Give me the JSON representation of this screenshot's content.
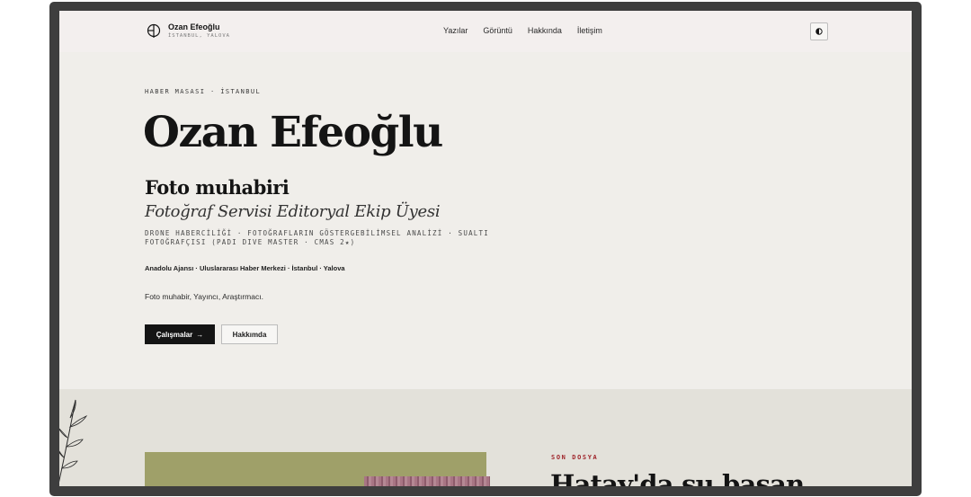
{
  "header": {
    "brand_name": "Ozan Efeoğlu",
    "brand_location": "İSTANBUL, YALOVA",
    "nav": [
      {
        "label": "Yazılar"
      },
      {
        "label": "Görüntü"
      },
      {
        "label": "Hakkında"
      },
      {
        "label": "İletişim"
      }
    ],
    "theme_toggle_icon": "half-circle-contrast-icon"
  },
  "hero": {
    "kicker": "HABER MASASI · İSTANBUL",
    "title": "Ozan Efeoğlu",
    "role": "Foto muhabiri",
    "role_subtitle": "Fotoğraf Servisi Editoryal Ekip Üyesi",
    "skills": "DRONE HABERCİLİĞİ · FOTOĞRAFLARIN GÖSTERGEBİLİMSEL ANALİZİ · SUALTI FOTOĞRAFÇISI (PADI DIVE MASTER · CMAS 2★)",
    "organizations": "Anadolu Ajansı · Uluslararası Haber Merkezi · İstanbul · Yalova",
    "bio": "Foto muhabir, Yayıncı, Araştırmacı.",
    "primary_button": "Çalışmalar",
    "primary_button_arrow": "→",
    "secondary_button": "Hakkımda"
  },
  "featured": {
    "kicker": "SON DOSYA",
    "title": "Hatay'da su basan"
  },
  "colors": {
    "background": "#f0eeea",
    "header_background": "#f3efee",
    "band_background": "#e3e1da",
    "text": "#141414",
    "accent_red": "#a0262c",
    "image_olive": "#9fa069"
  }
}
